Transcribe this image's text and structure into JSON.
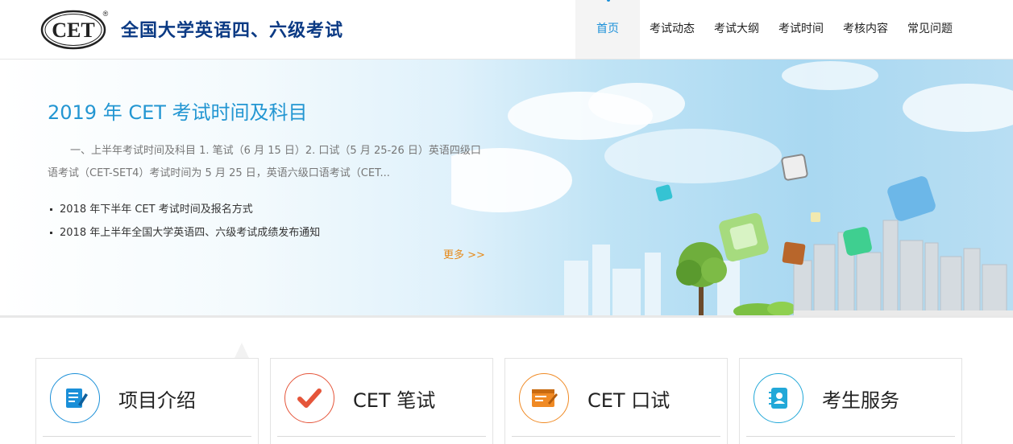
{
  "header": {
    "logo_text": "CET",
    "logo_mark": "®",
    "site_title": "全国大学英语四、六级考试"
  },
  "nav": {
    "items": [
      {
        "label": "首页",
        "active": true
      },
      {
        "label": "考试动态"
      },
      {
        "label": "考试大纲"
      },
      {
        "label": "考试时间"
      },
      {
        "label": "考核内容"
      },
      {
        "label": "常见问题"
      }
    ]
  },
  "banner": {
    "news_title": "2019 年 CET 考试时间及科目",
    "news_summary": "一、上半年考试时间及科目 1. 笔试（6 月 15 日）2. 口试（5 月 25-26 日）英语四级口语考试（CET-SET4）考试时间为 5 月 25 日，英语六级口语考试（CET...",
    "news_list": [
      "2018 年下半年 CET 考试时间及报名方式",
      "2018 年上半年全国大学英语四、六级考试成绩发布通知"
    ],
    "more_label": "更多 >>"
  },
  "cards": [
    {
      "title": "项目介绍",
      "icon": "document-icon",
      "color": "#1a8fd8"
    },
    {
      "title": "CET 笔试",
      "icon": "checkmark-icon",
      "color": "#e5553a"
    },
    {
      "title": "CET 口试",
      "icon": "browser-window-icon",
      "color": "#f08a24"
    },
    {
      "title": "考生服务",
      "icon": "address-book-icon",
      "color": "#22a8d8"
    }
  ],
  "colors": {
    "brand_blue": "#0b3a84",
    "accent_blue": "#2396d2",
    "more_orange": "#e68a1a"
  }
}
